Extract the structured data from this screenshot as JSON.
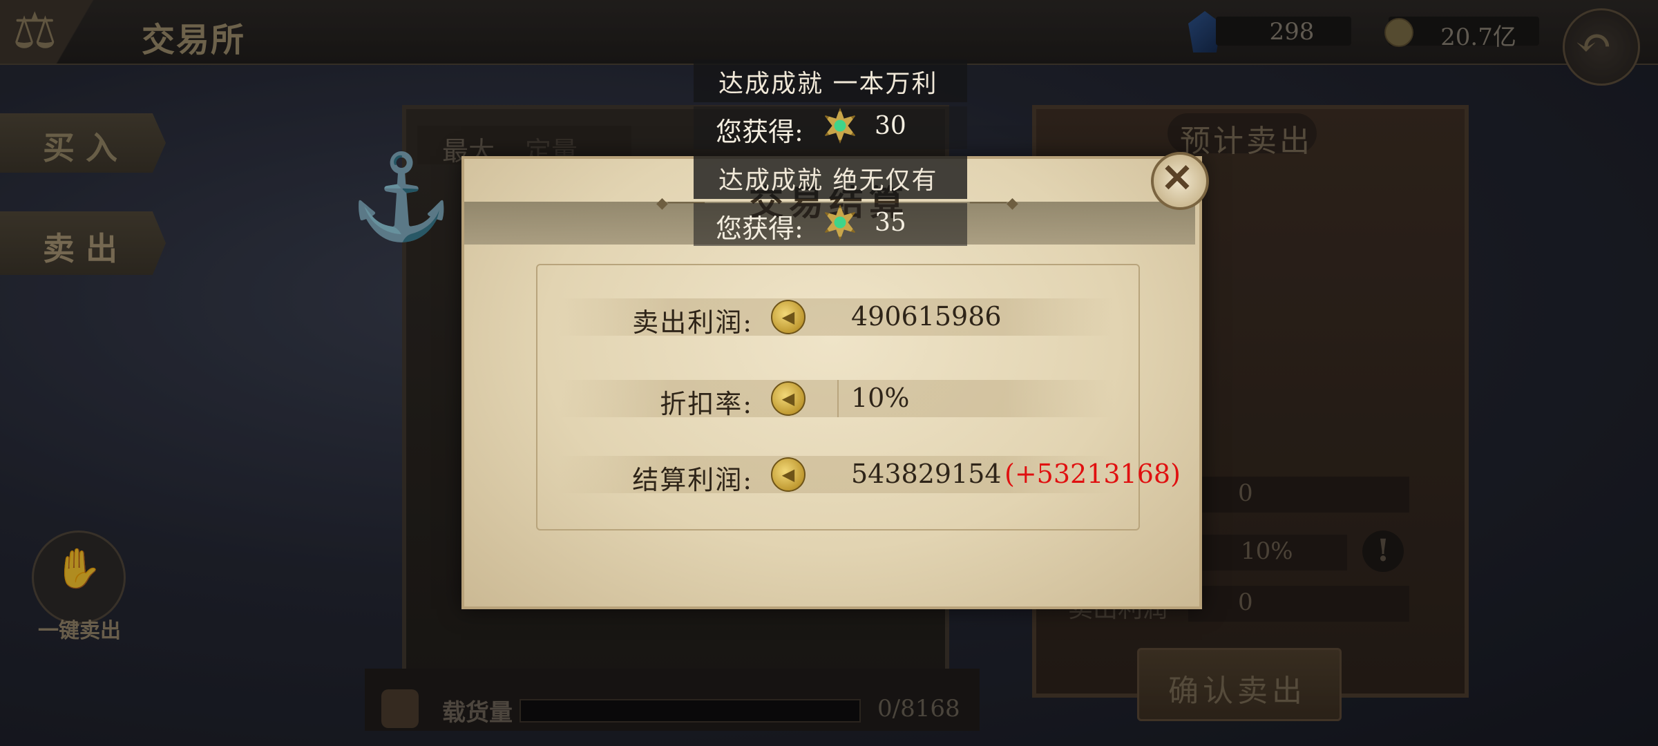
{
  "header": {
    "title": "交易所",
    "gems": "298",
    "gold": "20.7亿",
    "icons": {
      "emblem": "scales-icon",
      "gem": "blue-gem-icon",
      "gold": "gold-coin-icon",
      "back": "back-arrow-icon"
    }
  },
  "sidebar": {
    "buy_label": "买入",
    "sell_label": "卖出",
    "onekey_sell_label": "一键卖出"
  },
  "warehouse": {
    "tabs": [
      "最大",
      "定量"
    ],
    "cargo_label": "载货量",
    "cargo_value": "0/8168",
    "cargo_fill": 0
  },
  "estimate_panel": {
    "title": "预计卖出",
    "row1_value": "0",
    "row2_value": "10%",
    "row3_label": "卖出利润",
    "row3_value": "0",
    "confirm_label": "确认卖出"
  },
  "dialog": {
    "title": "交易结算",
    "profit_label": "卖出利润:",
    "profit_value": "490615986",
    "discount_label": "折扣率:",
    "discount_value": "10%",
    "settle_label": "结算利润:",
    "settle_value": "543829154",
    "settle_bonus": "(+53213168)",
    "bonus_color": "#e01010"
  },
  "achievements": [
    {
      "text": "达成成就 一本万利",
      "reward_label": "您获得:",
      "reward_value": "30"
    },
    {
      "text": "达成成就 绝无仅有",
      "reward_label": "您获得:",
      "reward_value": "35"
    }
  ]
}
